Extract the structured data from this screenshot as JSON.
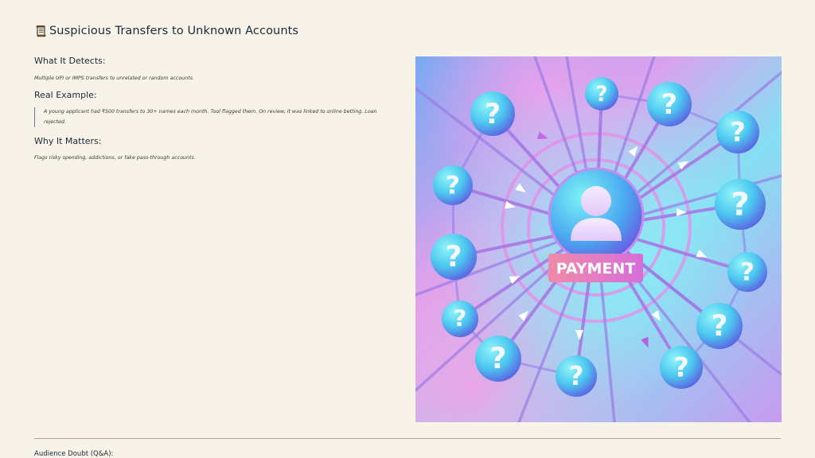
{
  "slide": {
    "icon": "scroll-icon",
    "title": "Suspicious Transfers to Unknown Accounts"
  },
  "sections": {
    "detects": {
      "heading": "What It Detects:",
      "text": "Multiple UPI or IMPS transfers to unrelated or random accounts."
    },
    "example": {
      "heading": "Real Example:",
      "text": "A young applicant had ₹500 transfers to 30+ names each month. Tool flagged them. On review, it was linked to online betting. Loan rejected."
    },
    "matters": {
      "heading": "Why It Matters:",
      "text": "Flags risky spending, addictions, or fake pass-through accounts."
    }
  },
  "illustration": {
    "label": "PAYMENT",
    "bubble_symbol": "?",
    "colors": {
      "bg_top_left": "#79aef0",
      "bg_pink": "#e9a0e8",
      "bg_cyan": "#7fe3f3",
      "web_line": "#b76fe0",
      "bubble_light": "#7ff0f6",
      "bubble_dark": "#4d6fe6",
      "label_bg": "#f07aa6"
    }
  },
  "footer": {
    "qa_label": "Audience Doubt (Q&A):"
  }
}
